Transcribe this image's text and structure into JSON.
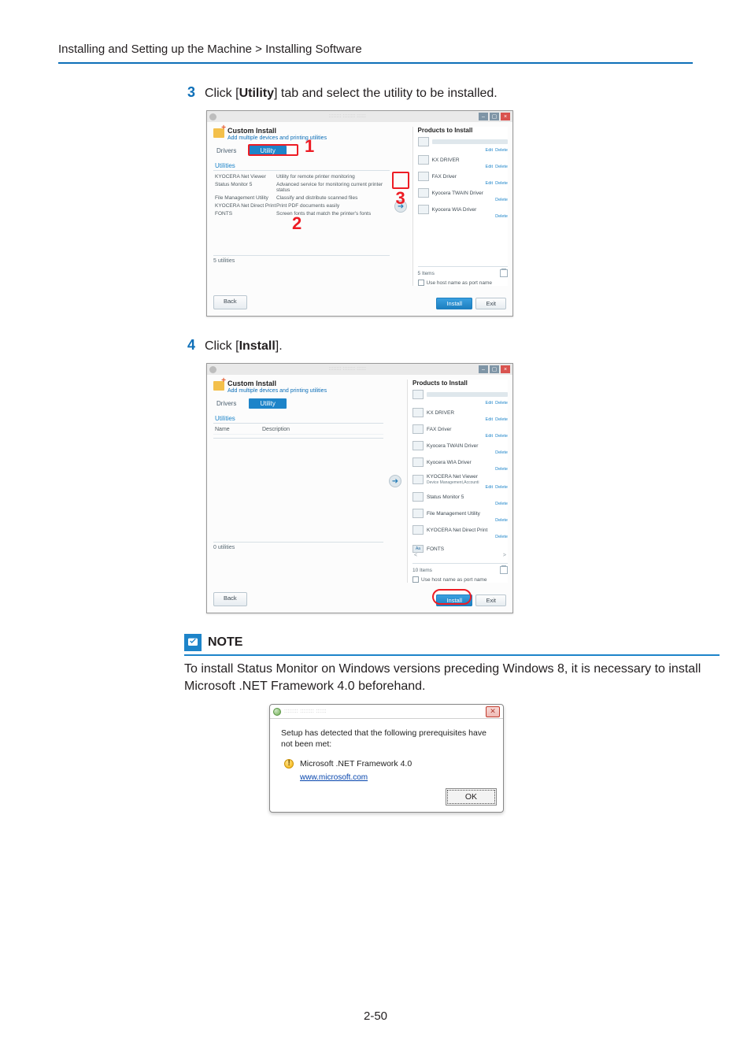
{
  "breadcrumb": "Installing and Setting up the Machine > Installing Software",
  "steps": {
    "s3": {
      "num": "3",
      "text_pre": "Click [",
      "bold": "Utility",
      "text_post": "] tab and select the utility to be installed."
    },
    "s4": {
      "num": "4",
      "text_pre": "Click [",
      "bold": "Install",
      "text_post": "]."
    }
  },
  "installer": {
    "title": "Custom Install",
    "subtitle": "Add multiple devices and printing utilities",
    "tab_drivers": "Drivers",
    "tab_utility": "Utility",
    "utilities_header": "Utilities",
    "col_name": "Name",
    "col_desc": "Description",
    "utils": [
      {
        "name": "KYOCERA Net Viewer",
        "desc": "Utility for remote printer monitoring"
      },
      {
        "name": "Status Monitor 5",
        "desc": "Advanced service for monitoring current printer status"
      },
      {
        "name": "File Management Utility",
        "desc": "Classify and distribute scanned files"
      },
      {
        "name": "KYOCERA Net Direct Print",
        "desc": "Print PDF documents easily"
      },
      {
        "name": "FONTS",
        "desc": "Screen fonts that match the printer's fonts"
      }
    ],
    "count5": "5 utilities",
    "count0": "0 utilities",
    "products_title": "Products to Install",
    "edit": "Edit",
    "delete": "Delete",
    "drivers": {
      "kx": "KX DRIVER",
      "fax": "FAX Driver",
      "twain": "Kyocera TWAIN Driver",
      "wia": "Kyocera WIA Driver"
    },
    "extra_items": {
      "netviewer": "KYOCERA Net Viewer",
      "netviewer_sub": "Device Management,Accounti",
      "status": "Status Monitor 5",
      "fmu": "File Management Utility",
      "ndp": "KYOCERA Net Direct Print",
      "fonts": "FONTS"
    },
    "items5": "5 Items",
    "items10": "10 Items",
    "use_host": "Use host name as port name",
    "back": "Back",
    "install": "Install",
    "exit": "Exit"
  },
  "callouts": {
    "c1": "1",
    "c2": "2",
    "c3": "3"
  },
  "note": {
    "title": "NOTE",
    "text": "To install Status Monitor on Windows versions preceding Windows 8, it is necessary to install Microsoft .NET Framework 4.0 beforehand."
  },
  "dialog": {
    "message": "Setup has detected that the following prerequisites have not been met:",
    "prereq": "Microsoft .NET Framework 4.0",
    "link": "www.microsoft.com",
    "ok": "OK"
  },
  "page_number": "2-50"
}
